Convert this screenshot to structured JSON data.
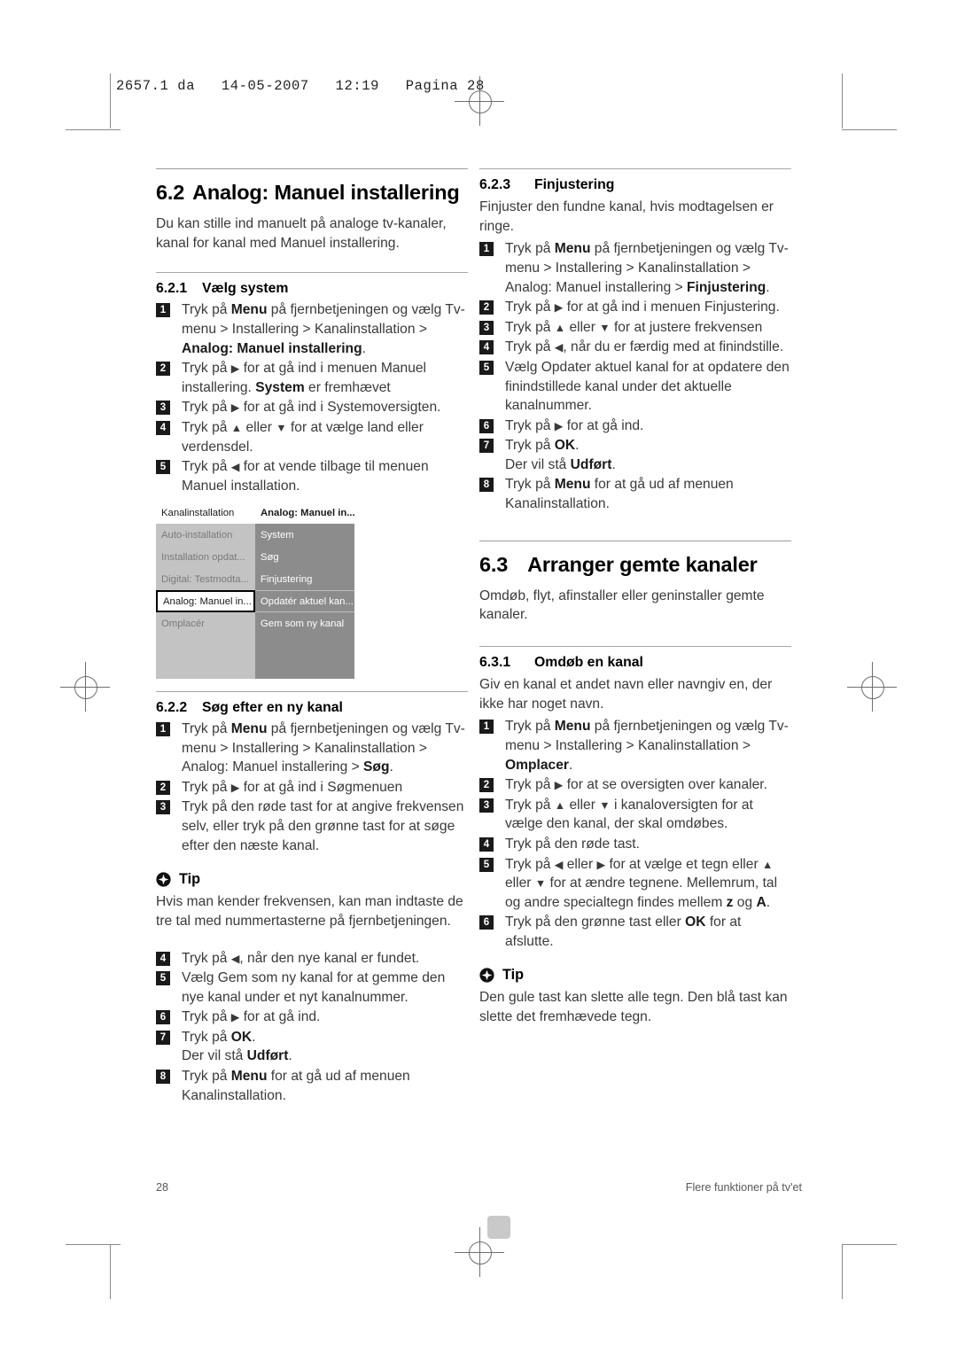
{
  "slug": "2657.1 da   14-05-2007   12:19   Pagina 28",
  "left_column": {
    "section": {
      "number": "6.2",
      "title": "Analog: Manuel installering",
      "intro": "Du kan stille ind manuelt på analoge tv-kanaler, kanal for kanal med Manuel installering."
    },
    "sub_621": {
      "number": "6.2.1",
      "title": "Vælg system",
      "steps": [
        "Tryk på <b>Menu</b> på fjernbetjeningen og vælg Tv-menu &gt; Installering &gt; Kanalinstallation &gt; <b>Analog: Manuel installering</b>.",
        "Tryk på <span class=\"arr\">&#9654;</span> for at gå ind i menuen Manuel installering. <b>System</b> er fremhævet",
        "Tryk på <span class=\"arr\">&#9654;</span> for at gå ind i Systemoversigten.",
        "Tryk på <span class=\"arr\">&#9650;</span> eller <span class=\"arr\">&#9660;</span> for at vælge land eller verdensdel.",
        "Tryk på <span class=\"arr\">&#9664;</span> for at vende tilbage til menuen Manuel installation."
      ]
    },
    "tv_menu": {
      "header_left": "Kanalinstallation",
      "header_right": "Analog: Manuel in...",
      "rows": [
        {
          "left": "Auto-installation",
          "right": "System"
        },
        {
          "left": "Installation opdat...",
          "right": "Søg"
        },
        {
          "left": "Digital: Testmodta...",
          "right": "Finjustering"
        },
        {
          "left": "Analog: Manuel in...",
          "right": "Opdatér aktuel kan...",
          "selected": true
        },
        {
          "left": "Omplacér",
          "right": "Gem som ny kanal"
        },
        {
          "left": "",
          "right": ""
        },
        {
          "left": "",
          "right": ""
        }
      ]
    },
    "sub_622": {
      "number": "6.2.2",
      "title": "Søg efter en ny kanal",
      "steps_a": [
        "Tryk på <b>Menu</b> på fjernbetjeningen og vælg Tv-menu &gt; Installering &gt; Kanalinstallation &gt; Analog: Manuel installering &gt; <b>Søg</b>.",
        "Tryk på <span class=\"arr\">&#9654;</span> for at gå ind i Søgmenuen",
        "Tryk på den røde tast for at angive frekvensen selv, eller tryk på den grønne tast for at søge efter den næste kanal."
      ],
      "tip": {
        "title": "Tip",
        "text": "Hvis man kender frekvensen, kan man indtaste de tre tal med nummertasterne på fjernbetjeningen."
      },
      "steps_b": [
        {
          "n": "4",
          "html": "Tryk på <span class=\"arr\">&#9664;</span>, når den nye kanal er fundet."
        },
        {
          "n": "5",
          "html": "Vælg Gem som ny kanal for at gemme den nye kanal under et nyt kanalnummer."
        },
        {
          "n": "6",
          "html": "Tryk på <span class=\"arr\">&#9654;</span> for at gå ind."
        },
        {
          "n": "7",
          "html": "Tryk på <b>OK</b>.<br>Der vil stå <b>Udført</b>."
        },
        {
          "n": "8",
          "html": "Tryk på <b>Menu</b> for at gå ud af menuen Kanalinstallation."
        }
      ]
    }
  },
  "right_column": {
    "sub_623": {
      "number": "6.2.3",
      "title": "Finjustering",
      "intro": "Finjuster den fundne kanal, hvis modtagelsen er ringe.",
      "steps": [
        "Tryk på <b>Menu</b> på fjernbetjeningen og vælg Tv-menu &gt; Installering &gt; Kanalinstallation &gt; Analog: Manuel installering &gt; <b>Finjustering</b>.",
        "Tryk på <span class=\"arr\">&#9654;</span> for at gå ind i menuen Finjustering.",
        "Tryk på <span class=\"arr\">&#9650;</span> eller <span class=\"arr\">&#9660;</span> for at justere frekvensen",
        "Tryk på <span class=\"arr\">&#9664;</span>, når du er færdig med at finindstille.",
        "Vælg Opdater aktuel kanal for at opdatere den finindstillede kanal under det aktuelle kanalnummer.",
        "Tryk på <span class=\"arr\">&#9654;</span> for at gå ind.",
        "Tryk på <b>OK</b>.<br>Der vil stå <b>Udført</b>.",
        "Tryk på <b>Menu</b> for at gå ud af menuen Kanalinstallation."
      ]
    },
    "section": {
      "number": "6.3",
      "title": "Arranger gemte kanaler",
      "intro": "Omdøb, flyt, afinstaller eller geninstaller gemte kanaler."
    },
    "sub_631": {
      "number": "6.3.1",
      "title": "Omdøb en kanal",
      "intro": "Giv en kanal et andet navn eller navngiv en, der ikke har noget navn.",
      "steps": [
        "Tryk på <b>Menu</b> på fjernbetjeningen og vælg Tv-menu &gt; Installering &gt; Kanalinstallation &gt; <b>Omplacer</b>.",
        "Tryk på <span class=\"arr\">&#9654;</span> for at se oversigten over kanaler.",
        "Tryk på <span class=\"arr\">&#9650;</span> eller <span class=\"arr\">&#9660;</span> i kanaloversigten for at vælge den kanal, der skal omdøbes.",
        "Tryk på den røde tast.",
        "Tryk på <span class=\"arr\">&#9664;</span> eller <span class=\"arr\">&#9654;</span> for at vælge et tegn eller <span class=\"arr\">&#9650;</span> eller <span class=\"arr\">&#9660;</span> for at ændre tegnene. Mellemrum, tal og andre specialtegn findes mellem <b>z</b> og <b>A</b>.",
        "Tryk på den grønne tast eller <b>OK</b> for at afslutte."
      ],
      "tip": {
        "title": "Tip",
        "text": "Den gule tast kan slette alle tegn. Den blå tast kan slette det fremhævede tegn."
      }
    }
  },
  "footer": {
    "page_number": "28",
    "running_title": "Flere funktioner på tv'et"
  }
}
